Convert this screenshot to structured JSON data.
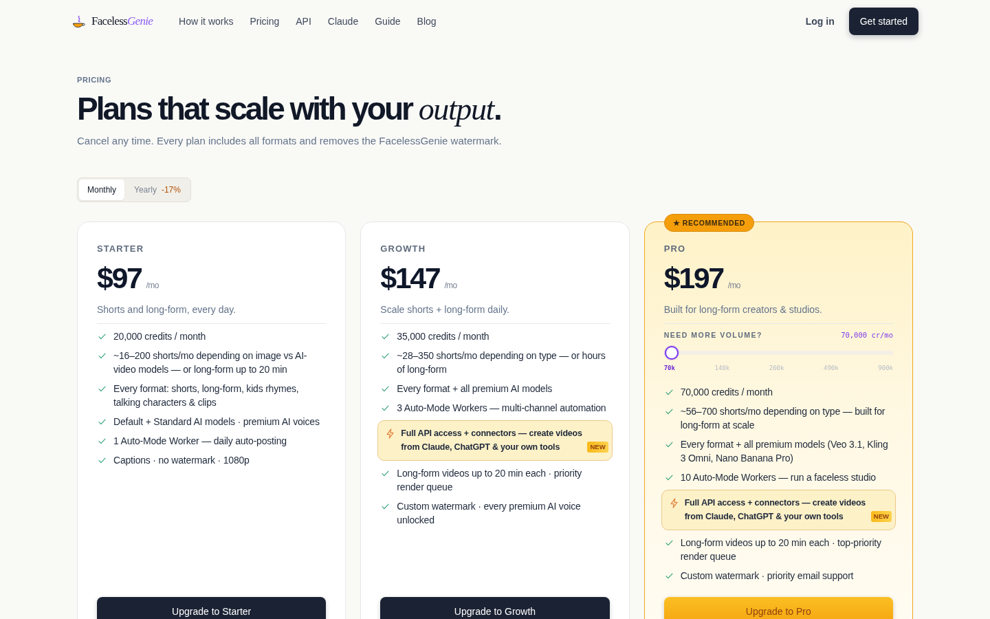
{
  "nav": {
    "brand": {
      "name": "Faceless",
      "accent": "Genie"
    },
    "links": [
      "How it works",
      "Pricing",
      "API",
      "Claude",
      "Guide",
      "Blog"
    ],
    "login": "Log in",
    "cta": "Get started"
  },
  "header": {
    "eyebrow": "PRICING",
    "title": "Plans that scale with your *output*.",
    "subtitle": "Cancel any time. Every plan includes all formats and removes the FacelessGenie watermark."
  },
  "billing": {
    "options": [
      {
        "label": "Monthly",
        "selected": true
      },
      {
        "label": "Yearly",
        "discount": "-17%",
        "selected": false
      }
    ]
  },
  "plans": [
    {
      "name": "STARTER",
      "price": "$97",
      "period": "/mo",
      "description": "Shorts and long-form, every day.",
      "recommended": false,
      "features": [
        {
          "kind": "check",
          "text": "20,000 credits / month"
        },
        {
          "kind": "check",
          "text": "~16–200 shorts/mo depending on image vs AI-video models — or long-form up to 20 min"
        },
        {
          "kind": "check",
          "text": "Every format: shorts, long-form, kids rhymes, talking characters & clips"
        },
        {
          "kind": "check",
          "text": "Default + Standard AI models · premium AI voices"
        },
        {
          "kind": "check",
          "text": "1 Auto-Mode Worker — daily auto-posting"
        },
        {
          "kind": "check",
          "text": "Captions · no watermark · 1080p"
        }
      ],
      "button": "Upgrade to Starter"
    },
    {
      "name": "GROWTH",
      "price": "$147",
      "period": "/mo",
      "description": "Scale shorts + long-form daily.",
      "recommended": false,
      "features": [
        {
          "kind": "check",
          "text": "35,000 credits / month"
        },
        {
          "kind": "check",
          "text": "~28–350 shorts/mo depending on type — or hours of long-form"
        },
        {
          "kind": "check",
          "text": "Every format + all premium AI models"
        },
        {
          "kind": "check",
          "text": "3 Auto-Mode Workers — multi-channel automation"
        },
        {
          "kind": "highlight",
          "text": "Full API access + connectors — create videos from Claude, ChatGPT & your own tools",
          "tag": "NEW"
        },
        {
          "kind": "check",
          "text": "Long-form videos up to 20 min each · priority render queue"
        },
        {
          "kind": "check",
          "text": "Custom watermark · every premium AI voice unlocked"
        }
      ],
      "button": "Upgrade to Growth"
    },
    {
      "name": "PRO",
      "price": "$197",
      "period": "/mo",
      "description": "Built for long-form creators & studios.",
      "recommended": true,
      "badge": "★ RECOMMENDED",
      "volume": {
        "label": "NEED MORE VOLUME?",
        "reading": "70,000 cr/mo",
        "level": 0,
        "ticks": [
          {
            "label": "70k",
            "selected": true
          },
          {
            "label": "140k",
            "selected": false
          },
          {
            "label": "260k",
            "selected": false
          },
          {
            "label": "490k",
            "selected": false
          },
          {
            "label": "900k",
            "selected": false
          }
        ]
      },
      "features": [
        {
          "kind": "check",
          "text": "70,000 credits / month"
        },
        {
          "kind": "check",
          "text": "~56–700 shorts/mo depending on type — built for long-form at scale"
        },
        {
          "kind": "check",
          "text": "Every format + all premium models (Veo 3.1, Kling 3 Omni, Nano Banana Pro)"
        },
        {
          "kind": "check",
          "text": "10 Auto-Mode Workers — run a faceless studio"
        },
        {
          "kind": "highlight",
          "text": "Full API access + connectors — create videos from Claude, ChatGPT & your own tools",
          "tag": "NEW"
        },
        {
          "kind": "check",
          "text": "Long-form videos up to 20 min each · top-priority render queue"
        },
        {
          "kind": "check",
          "text": "Custom watermark · priority email support"
        }
      ],
      "button": "Upgrade to Pro"
    }
  ]
}
